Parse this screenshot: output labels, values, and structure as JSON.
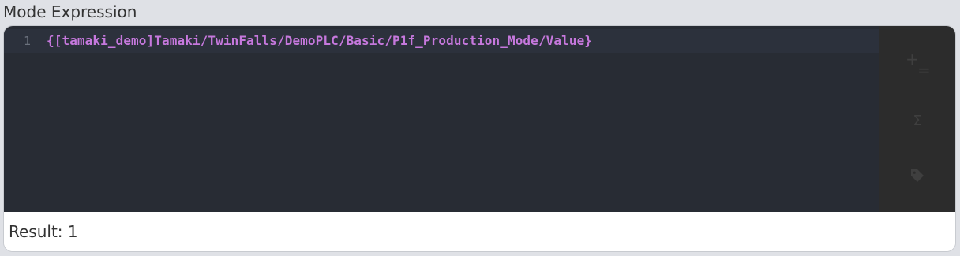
{
  "field": {
    "label": "Mode Expression"
  },
  "editor": {
    "lines": [
      {
        "number": "1",
        "text": "{[tamaki_demo]Tamaki/TwinFalls/DemoPLC/Basic/P1f_Production_Mode/Value}"
      }
    ]
  },
  "toolbar": {
    "items": [
      {
        "name": "operators",
        "icon": "plus-equals-icon",
        "glyph_plus": "+",
        "glyph_eq": "="
      },
      {
        "name": "functions",
        "icon": "sigma-icon",
        "glyph": "Σ"
      },
      {
        "name": "tags",
        "icon": "tag-icon"
      }
    ]
  },
  "result": {
    "text": "Result: 1"
  },
  "colors": {
    "page_bg": "#dfe1e6",
    "editor_bg": "#282c34",
    "active_line_bg": "#2c313c",
    "code_text": "#c678dd",
    "line_number": "#6b717d",
    "toolbar_bg": "#2c2c2c",
    "toolbar_icon": "#3f3f3f"
  }
}
